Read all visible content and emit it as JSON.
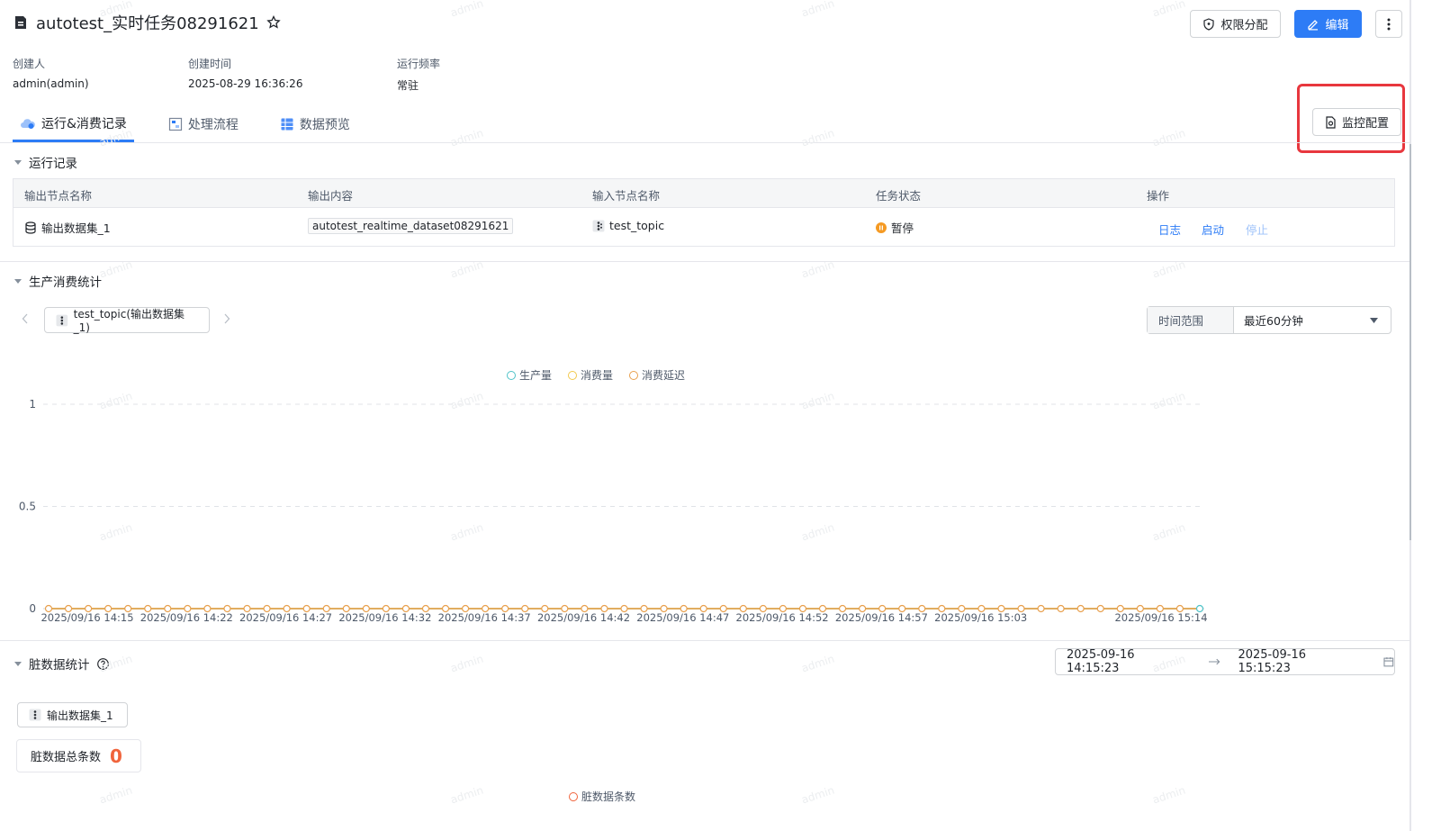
{
  "header": {
    "title": "autotest_实时任务08291621",
    "permission_button": "权限分配",
    "edit_button": "编辑"
  },
  "meta": {
    "creator_label": "创建人",
    "creator_value": "admin(admin)",
    "created_label": "创建时间",
    "created_value": "2025-08-29 16:36:26",
    "frequency_label": "运行频率",
    "frequency_value": "常驻"
  },
  "tabs": [
    {
      "label": "运行&消费记录"
    },
    {
      "label": "处理流程"
    },
    {
      "label": "数据预览"
    }
  ],
  "monitor_button": "监控配置",
  "run_records": {
    "title": "运行记录",
    "columns": [
      "输出节点名称",
      "输出内容",
      "输入节点名称",
      "任务状态",
      "操作"
    ],
    "row": {
      "output_node": "输出数据集_1",
      "output_content": "autotest_realtime_dataset08291621",
      "input_node": "test_topic",
      "status": "暂停",
      "actions": [
        "日志",
        "启动",
        "停止"
      ]
    }
  },
  "stats": {
    "title": "生产消费统计",
    "topic_tab": "test_topic(输出数据集_1)",
    "time_range_label": "时间范围",
    "time_range_value": "最近60分钟"
  },
  "chart_data": {
    "type": "line",
    "series": [
      {
        "name": "生产量",
        "color": "#4fc3c8"
      },
      {
        "name": "消费量",
        "color": "#f2c94c"
      },
      {
        "name": "消费延迟",
        "color": "#e8a04e"
      }
    ],
    "x_tick_labels": [
      "2025/09/16 14:15",
      "2025/09/16 14:22",
      "2025/09/16 14:27",
      "2025/09/16 14:32",
      "2025/09/16 14:37",
      "2025/09/16 14:42",
      "2025/09/16 14:47",
      "2025/09/16 14:52",
      "2025/09/16 14:57",
      "2025/09/16 15:03",
      "2025/09/16 15:14"
    ],
    "y_tick_labels": [
      "1",
      "0.5",
      "0"
    ],
    "ylim": [
      0,
      1
    ],
    "values": "all 0",
    "grid": true,
    "legend": "top-center"
  },
  "dirty": {
    "title": "脏数据统计",
    "date_start": "2025-09-16 14:15:23",
    "date_end": "2025-09-16 15:15:23",
    "node_tab": "输出数据集_1",
    "total_label": "脏数据总条数",
    "total_value": "0",
    "legend": "脏数据条数"
  },
  "watermark": "admin"
}
